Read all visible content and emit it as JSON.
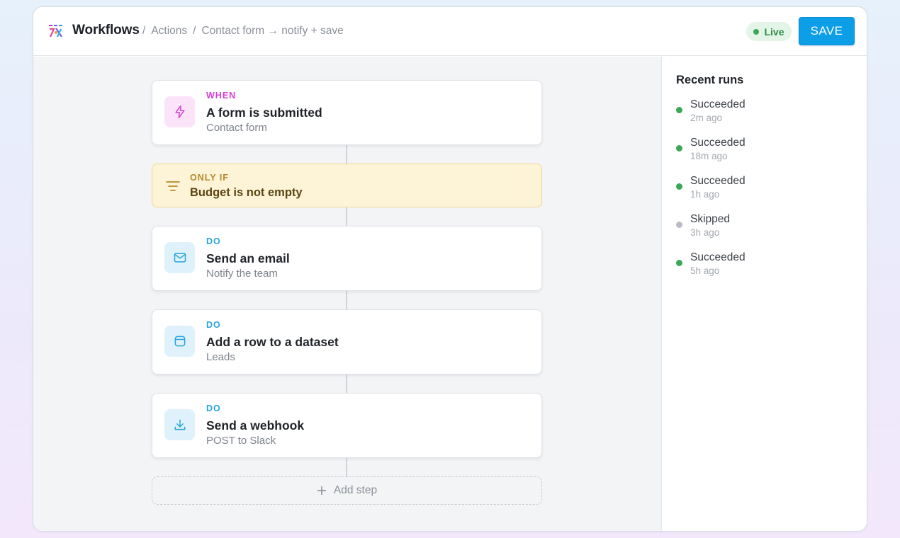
{
  "header": {
    "app_title": "Workflows",
    "breadcrumb_sep": "/",
    "breadcrumbs": [
      "Actions",
      "Contact form → notify + save"
    ],
    "status_badge": "Live",
    "save_label": "SAVE"
  },
  "colors": {
    "accent": "#0d9ee8",
    "live_green": "#3aa757",
    "trigger_pink": "#d63fd0",
    "action_blue": "#2aa4dc",
    "filter_amber": "#b4892a",
    "skipped_gray": "#b9bdc3"
  },
  "steps": [
    {
      "kicker": "WHEN",
      "title": "A form is submitted",
      "subtitle": "Contact form",
      "icon": "lightning-icon",
      "type": "trigger"
    },
    {
      "kicker": "ONLY IF",
      "title": "Budget is not empty",
      "icon": "filter-icon",
      "type": "filter"
    },
    {
      "kicker": "DO",
      "title": "Send an email",
      "subtitle": "Notify the team",
      "icon": "mail-icon",
      "type": "action"
    },
    {
      "kicker": "DO",
      "title": "Add a row to a dataset",
      "subtitle": "Leads",
      "icon": "database-icon",
      "type": "action"
    },
    {
      "kicker": "DO",
      "title": "Send a webhook",
      "subtitle": "POST to Slack",
      "icon": "download-icon",
      "type": "action"
    }
  ],
  "add_step_label": "Add step",
  "recent_runs": {
    "title": "Recent runs",
    "items": [
      {
        "status": "Succeeded",
        "time": "2m ago",
        "state": "success"
      },
      {
        "status": "Succeeded",
        "time": "18m ago",
        "state": "success"
      },
      {
        "status": "Succeeded",
        "time": "1h ago",
        "state": "success"
      },
      {
        "status": "Skipped",
        "time": "3h ago",
        "state": "skipped"
      },
      {
        "status": "Succeeded",
        "time": "5h ago",
        "state": "success"
      }
    ]
  }
}
